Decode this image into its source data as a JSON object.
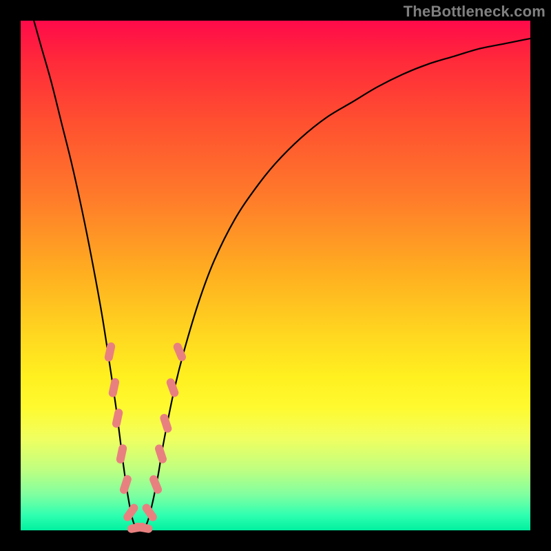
{
  "watermark": "TheBottleneck.com",
  "chart_data": {
    "type": "line",
    "title": "",
    "xlabel": "",
    "ylabel": "",
    "x_range": [
      0,
      100
    ],
    "y_range": [
      0,
      100
    ],
    "series": [
      {
        "name": "curve",
        "x": [
          0,
          2,
          4,
          6,
          8,
          10,
          12,
          14,
          16,
          18,
          19,
          20,
          21,
          22,
          23,
          24,
          25,
          26,
          27,
          28,
          30,
          32,
          35,
          38,
          42,
          46,
          50,
          55,
          60,
          65,
          70,
          75,
          80,
          85,
          90,
          95,
          100
        ],
        "y": [
          108,
          102,
          95,
          88,
          80,
          72,
          63,
          53,
          42,
          29,
          22,
          14,
          7,
          2,
          0,
          0,
          2,
          6,
          11,
          17,
          27,
          35,
          45,
          53,
          61,
          67,
          72,
          77,
          81,
          84,
          87,
          89.5,
          91.5,
          93,
          94.5,
          95.5,
          96.5
        ]
      }
    ],
    "markers": {
      "name": "highlighted-points",
      "shape": "capsule",
      "color": "#e98080",
      "points": [
        {
          "x": 17.5,
          "y": 35,
          "angle": -78
        },
        {
          "x": 18.3,
          "y": 28,
          "angle": -78
        },
        {
          "x": 19.0,
          "y": 22,
          "angle": -78
        },
        {
          "x": 19.8,
          "y": 15,
          "angle": -78
        },
        {
          "x": 20.6,
          "y": 9,
          "angle": -72
        },
        {
          "x": 21.6,
          "y": 3.5,
          "angle": -55
        },
        {
          "x": 22.8,
          "y": 0.5,
          "angle": -10
        },
        {
          "x": 24.0,
          "y": 0.5,
          "angle": 10
        },
        {
          "x": 25.3,
          "y": 3.5,
          "angle": 55
        },
        {
          "x": 26.5,
          "y": 9,
          "angle": 68
        },
        {
          "x": 27.5,
          "y": 15,
          "angle": 72
        },
        {
          "x": 28.5,
          "y": 21,
          "angle": 72
        },
        {
          "x": 29.8,
          "y": 28,
          "angle": 70
        },
        {
          "x": 31.2,
          "y": 35,
          "angle": 67
        }
      ]
    },
    "gradient_stops": [
      {
        "pos": 0.0,
        "color": "#ff0a4a"
      },
      {
        "pos": 0.5,
        "color": "#ffb020"
      },
      {
        "pos": 0.76,
        "color": "#fffa30"
      },
      {
        "pos": 1.0,
        "color": "#00f0a0"
      }
    ]
  }
}
